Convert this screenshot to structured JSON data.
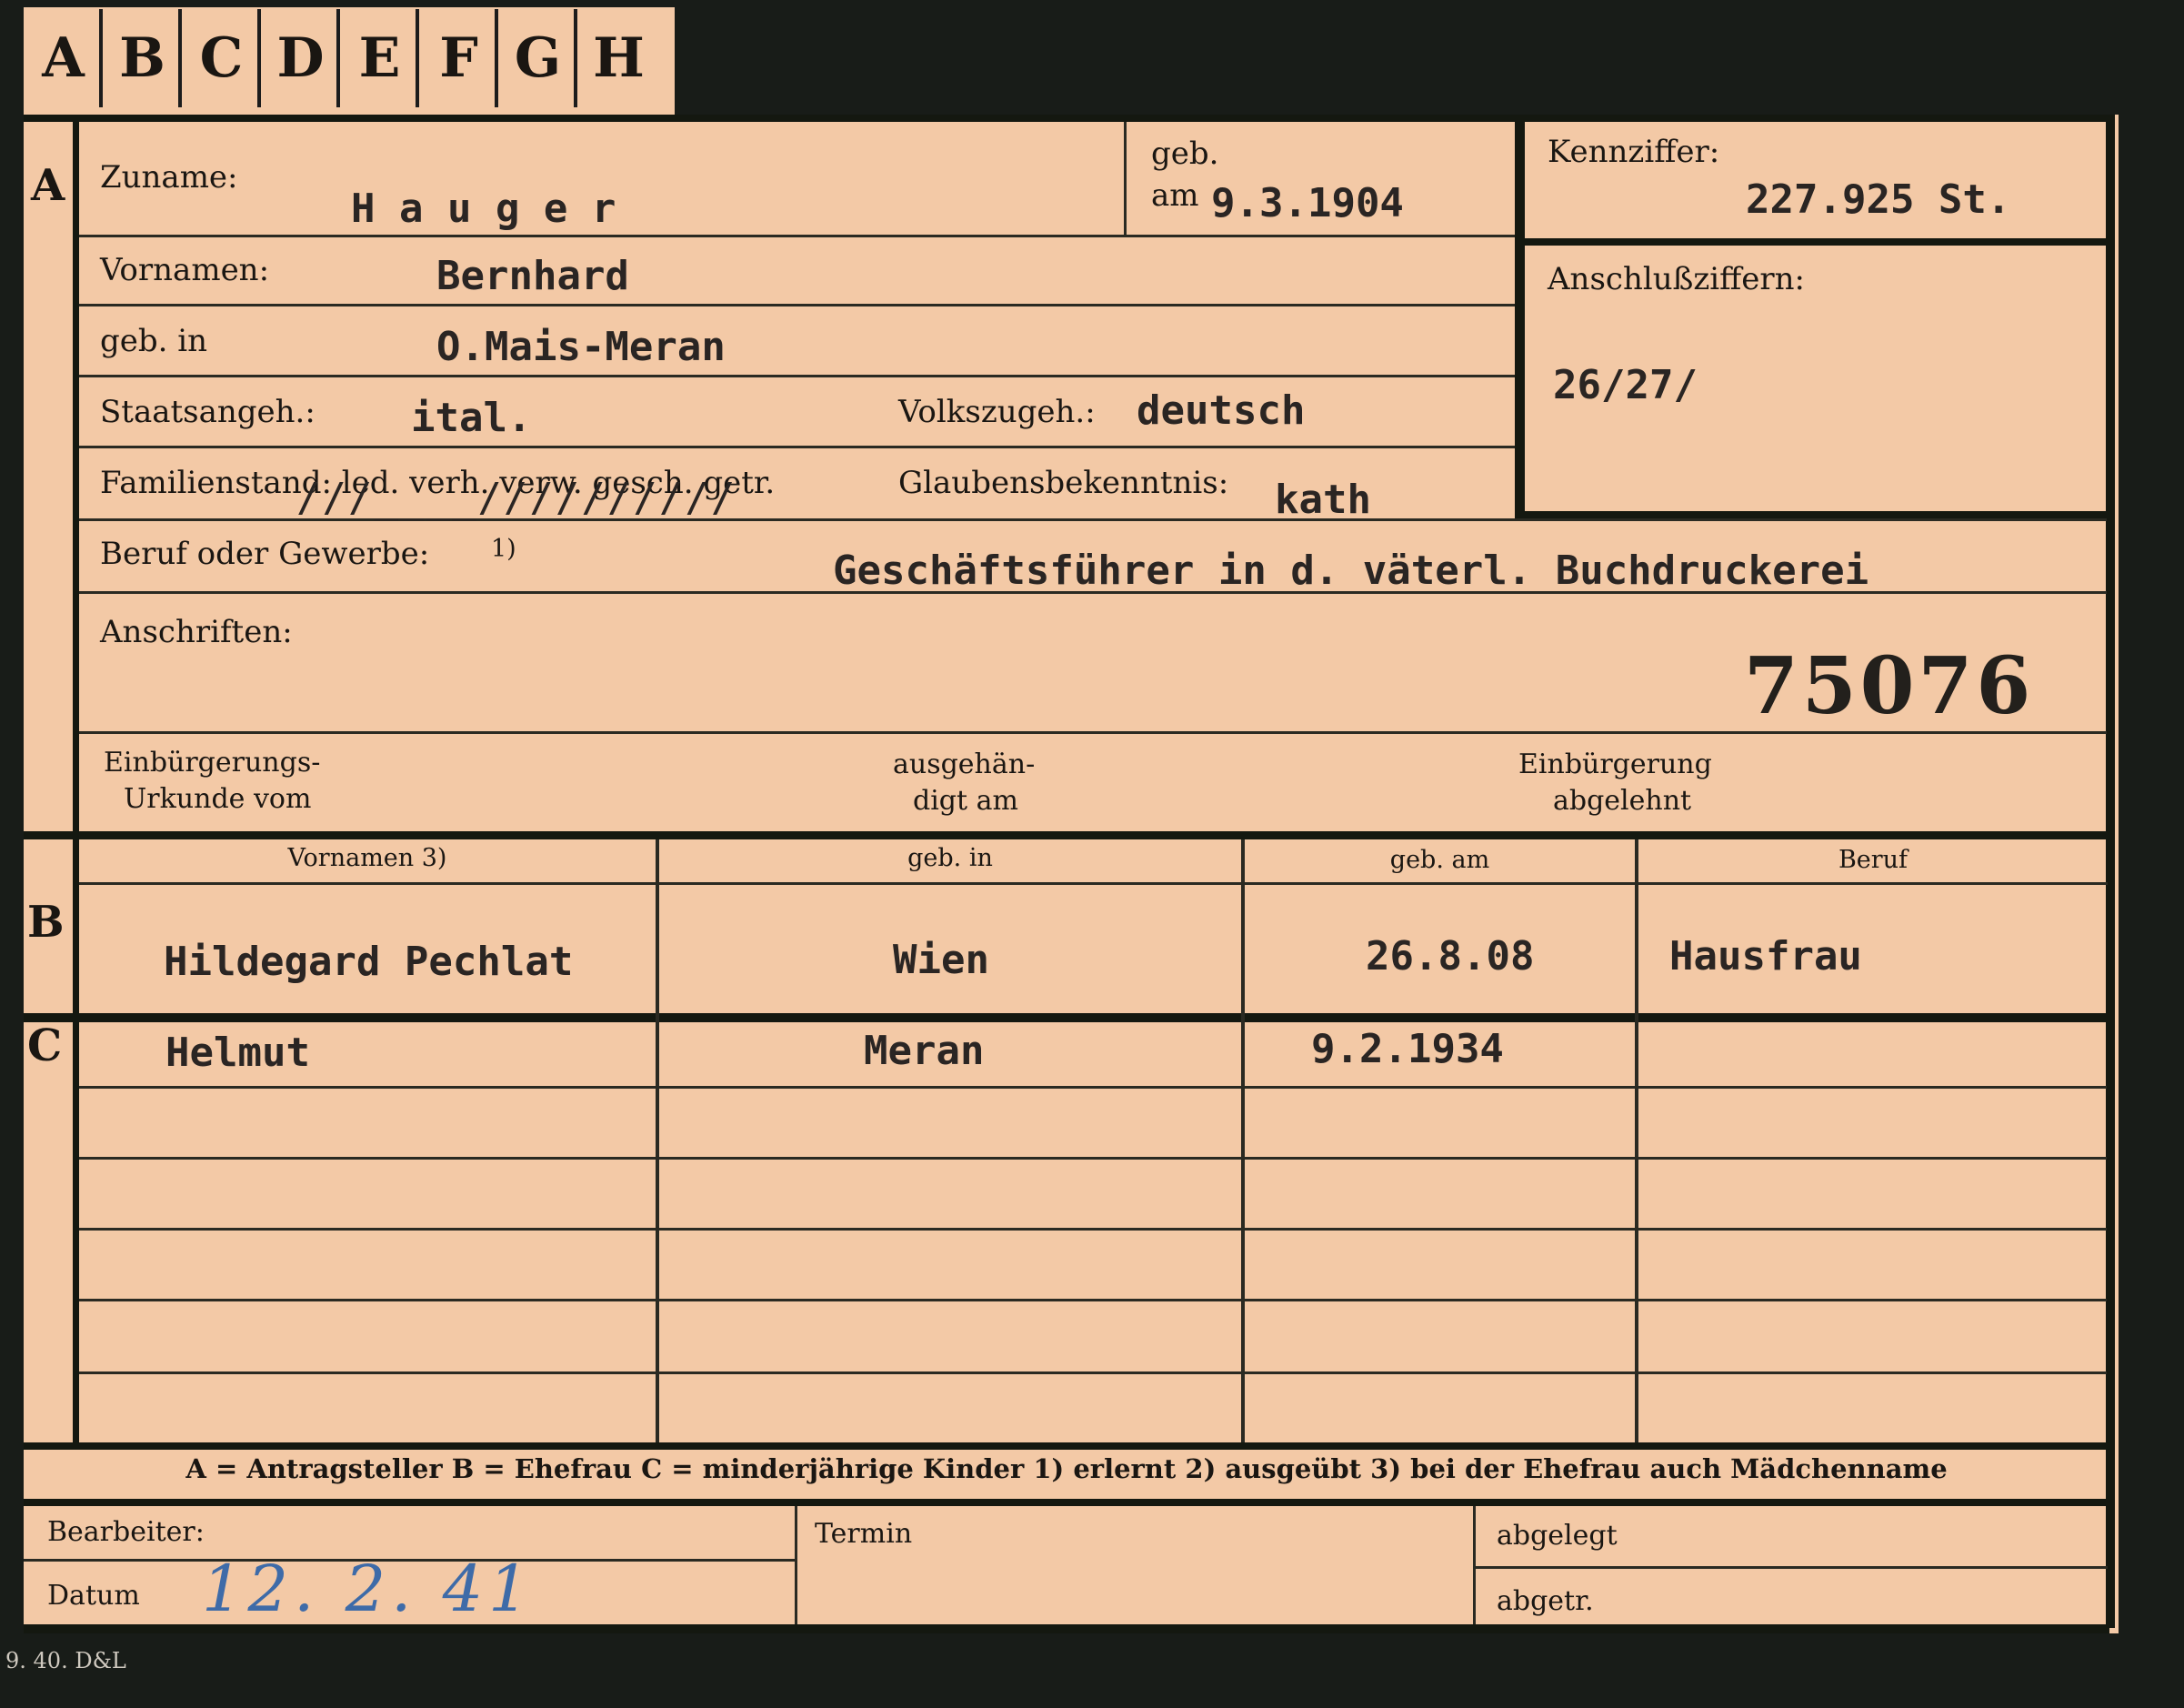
{
  "tabs": [
    "A",
    "B",
    "C",
    "D",
    "E",
    "F",
    "G",
    "H"
  ],
  "sections": {
    "a": "A",
    "b": "B",
    "c": "C"
  },
  "labels": {
    "zuname": "Zuname:",
    "geb_am_1": "geb.",
    "geb_am_2": "am",
    "kennziffer": "Kennziffer:",
    "vornamen": "Vornamen:",
    "anschlussziffern": "Anschlußziffern:",
    "geb_in": "geb. in",
    "staatsangeh": "Staatsangeh.:",
    "volkszugeh": "Volkszugeh.:",
    "familienstand": "Familienstand: led. verh. verw. gesch. getr.",
    "glaubensbekenntnis": "Glaubensbekenntnis:",
    "beruf": "Beruf oder Gewerbe:",
    "beruf_note": "1)",
    "anschriften": "Anschriften:",
    "einbuergerung_1": "Einbürgerungs-",
    "einbuergerung_2": "Urkunde vom",
    "ausgehaendigt_1": "ausgehän-",
    "ausgehaendigt_2": "digt am",
    "abgelehnt_1": "Einbürgerung",
    "abgelehnt_2": "abgelehnt",
    "bearbeiter": "Bearbeiter:",
    "datum": "Datum",
    "termin": "Termin",
    "abgelegt": "abgelegt",
    "abgetr": "abgetr."
  },
  "values": {
    "zuname": "H a u g e r",
    "geb_am": "9.3.1904",
    "kennziffer": "227.925  St.",
    "vornamen": "Bernhard",
    "anschlussziffern": "26/27/",
    "geb_in": "O.Mais-Meran",
    "staatsangeh": "ital.",
    "volkszugeh": "deutsch",
    "familienstand_marks": "///____//////////",
    "glaubensbekenntnis": "kath",
    "beruf": "Geschäftsführer in d. väterl. Buchdruckerei",
    "stamp_number": "75076",
    "datum": "12. 2. 41"
  },
  "ehefrau": {
    "headers": [
      "Vornamen 3)",
      "geb. in",
      "geb. am",
      "Beruf"
    ],
    "row": [
      "Hildegard Pechlat",
      "Wien",
      "26.8.08",
      "Hausfrau"
    ]
  },
  "kinder": [
    [
      "Helmut",
      "Meran",
      "9.2.1934",
      ""
    ]
  ],
  "legend": "A = Antragsteller    B = Ehefrau    C = minderjährige Kinder    1) erlernt    2) ausgeübt    3) bei der Ehefrau auch Mädchenname",
  "print_mark": "9. 40. D&L"
}
